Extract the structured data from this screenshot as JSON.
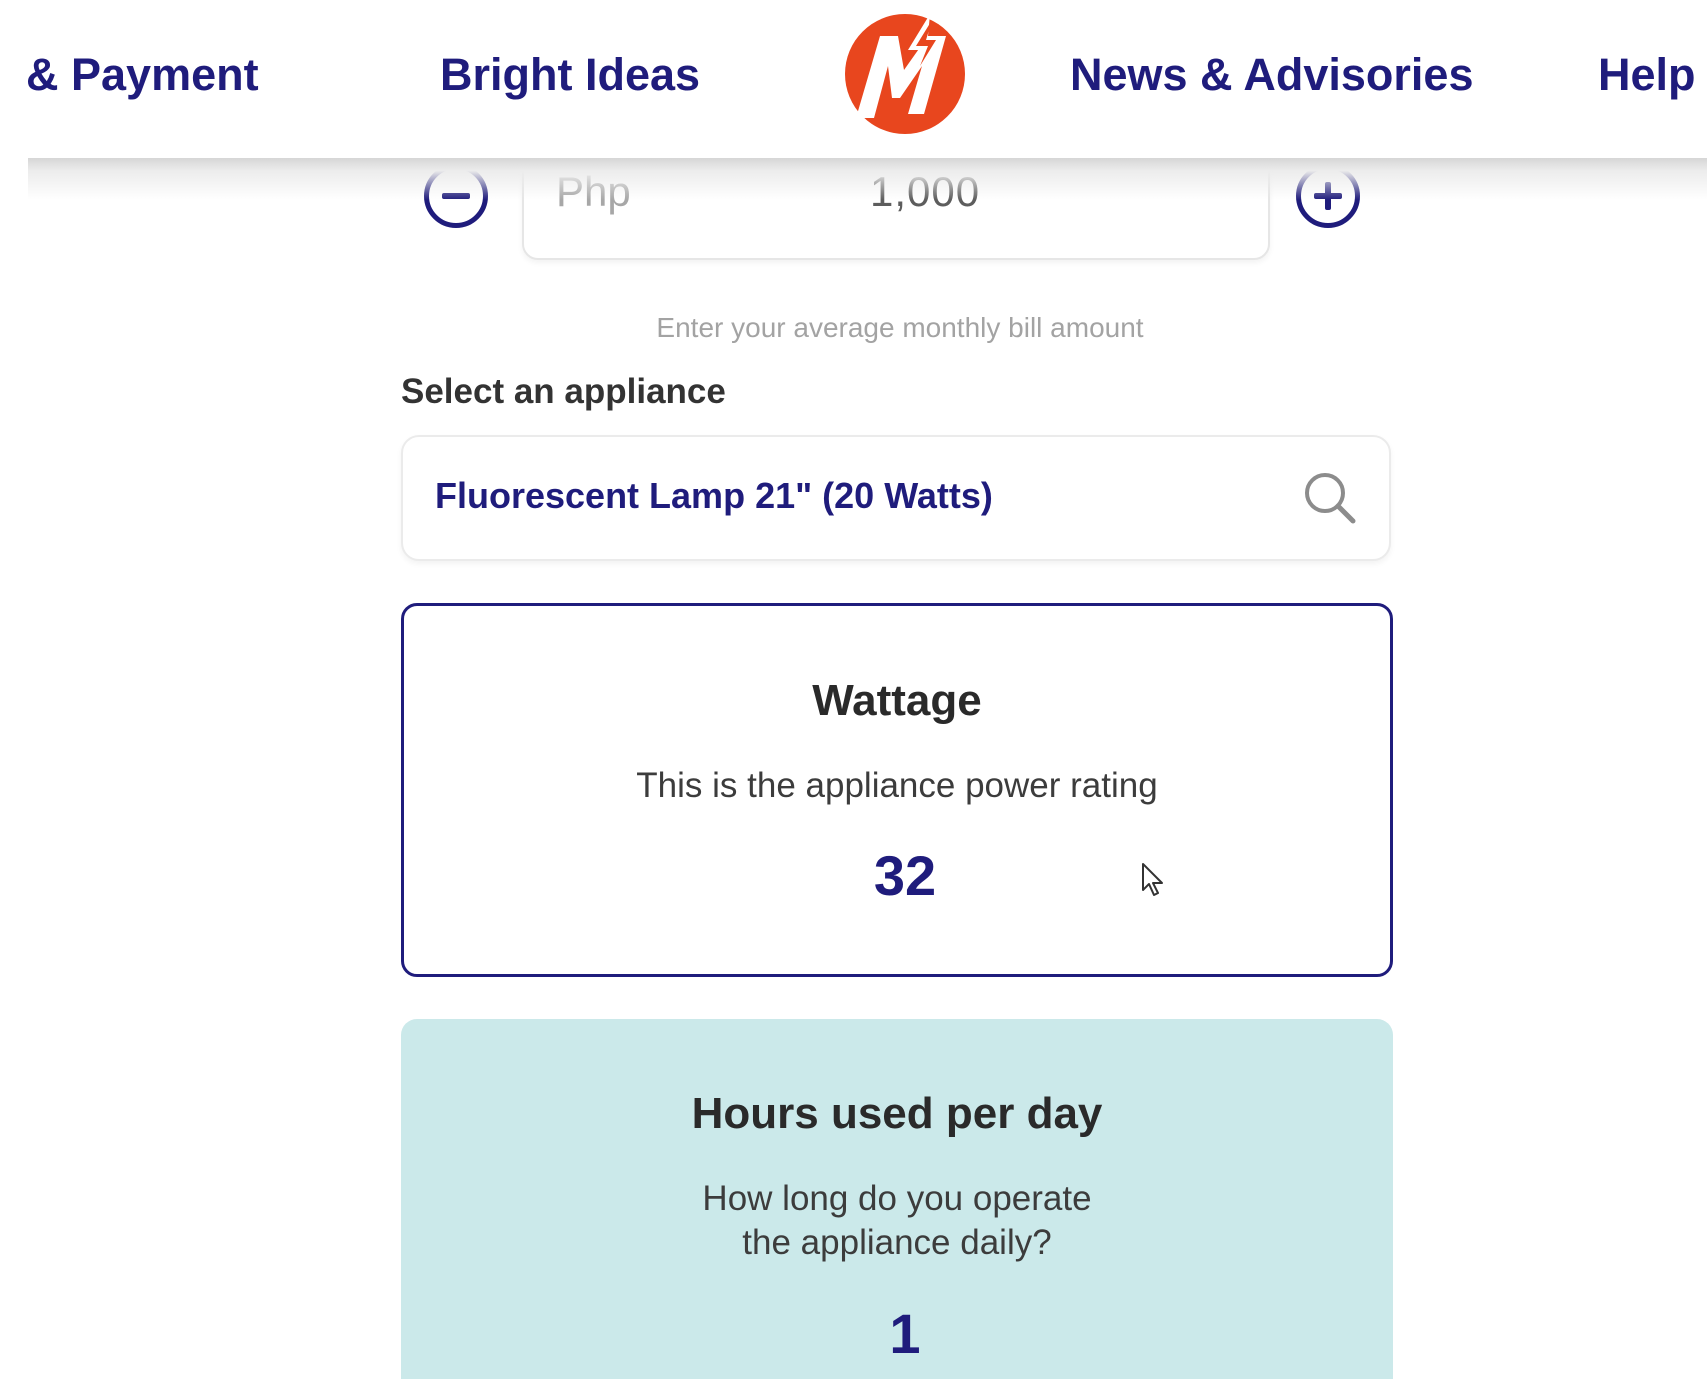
{
  "nav": {
    "billing_label": "& Payment",
    "bright_ideas_label": "Bright Ideas",
    "news_label": "News & Advisories",
    "help_label": "Help",
    "logo_icon": "meralco-logo-icon"
  },
  "bill": {
    "currency": "Php",
    "amount": "1,000",
    "hint": "Enter your average monthly bill amount",
    "decrease_icon": "minus-circle-icon",
    "increase_icon": "plus-circle-icon"
  },
  "appliance": {
    "label": "Select an appliance",
    "selected": "Fluorescent Lamp 21\" (20 Watts)",
    "icon": "search-icon"
  },
  "wattage_card": {
    "title": "Wattage",
    "description": "This is the appliance power rating",
    "value": "32"
  },
  "hours_card": {
    "title": "Hours used per day",
    "description_line1": "How long do you operate",
    "description_line2": "the appliance daily?",
    "value": "1"
  },
  "colors": {
    "brand_navy": "#1f1c7c",
    "brand_orange": "#e8461e",
    "hours_card_bg": "#cbe9ea"
  }
}
